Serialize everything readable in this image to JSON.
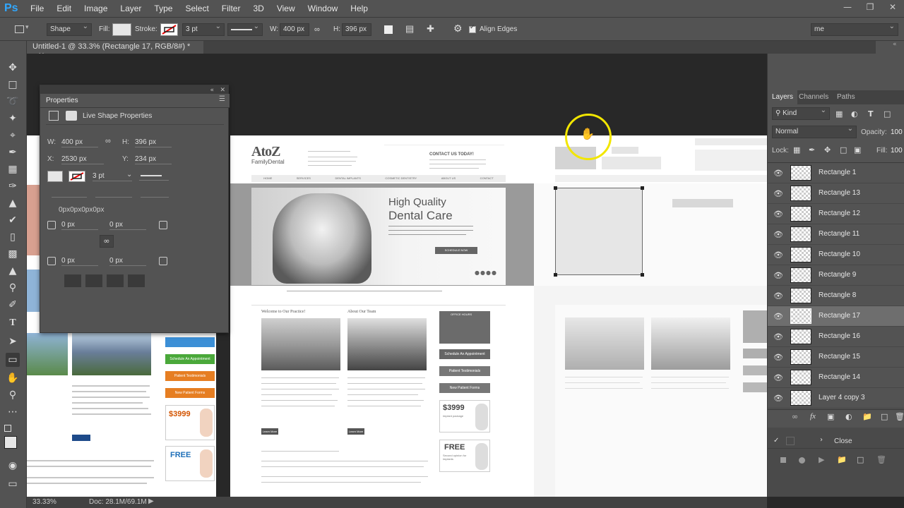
{
  "app": {
    "logo": "Ps",
    "menus": [
      "File",
      "Edit",
      "Image",
      "Layer",
      "Type",
      "Select",
      "Filter",
      "3D",
      "View",
      "Window",
      "Help"
    ]
  },
  "options": {
    "mode": "Shape",
    "fill_label": "Fill:",
    "stroke_label": "Stroke:",
    "stroke_width": "3 pt",
    "w_label": "W:",
    "w_value": "400 px",
    "h_label": "H:",
    "h_value": "396 px",
    "align_edges": "Align Edges",
    "workspace": "me"
  },
  "document": {
    "tab": "Untitled-1 @ 33.3% (Rectangle 17, RGB/8#) *"
  },
  "properties": {
    "title": "Properties",
    "subtitle": "Live Shape Properties",
    "w_label": "W:",
    "w": "400 px",
    "h_label": "H:",
    "h": "396 px",
    "x_label": "X:",
    "x": "2530 px",
    "y_label": "Y:",
    "y": "234 px",
    "stroke": "3 pt",
    "radii": "0px0px0px0px",
    "r1": "0 px",
    "r2": "0 px",
    "r3": "0 px",
    "r4": "0 px"
  },
  "panels": {
    "tabs": [
      "Layers",
      "Channels",
      "Paths"
    ],
    "filter": "Kind",
    "blend": "Normal",
    "opacity_label": "Opacity:",
    "opacity": "100",
    "lock_label": "Lock:",
    "fill_label": "Fill:",
    "fill": "100",
    "layers": [
      {
        "name": "Rectangle 1",
        "selected": false
      },
      {
        "name": "Rectangle 13",
        "selected": false
      },
      {
        "name": "Rectangle 12",
        "selected": false
      },
      {
        "name": "Rectangle 11",
        "selected": false
      },
      {
        "name": "Rectangle 10",
        "selected": false
      },
      {
        "name": "Rectangle 9",
        "selected": false
      },
      {
        "name": "Rectangle 8",
        "selected": false
      },
      {
        "name": "Rectangle 17",
        "selected": true
      },
      {
        "name": "Rectangle 16",
        "selected": false
      },
      {
        "name": "Rectangle 15",
        "selected": false
      },
      {
        "name": "Rectangle 14",
        "selected": false
      },
      {
        "name": "Layer 4 copy 3",
        "selected": false
      }
    ],
    "actions_close": "Close"
  },
  "status": {
    "zoom": "33.33%",
    "doc": "Doc: 28.1M/69.1M"
  },
  "website": {
    "logo_az": "AtoZ",
    "logo_sub": "FamilyDental",
    "contact": "CONTACT US TODAY!",
    "hero_title1": "High Quality",
    "hero_title2": "Dental Care",
    "hero_btn": "SCHEDULE NOW",
    "nav": [
      "HOME",
      "SERVICES",
      "DENTAL IMPLANTS",
      "COSMETIC DENTISTRY",
      "ABOUT US",
      "CONTACT"
    ],
    "welcome": "Welcome to Our Practice!",
    "about": "About Our Team",
    "hours": "OFFICE HOURS",
    "btn1": "Schedule An Appointment",
    "btn2": "Patient Testimonials",
    "btn3": "New Patient Forms",
    "price": "$3999",
    "price_sub": "implant package",
    "free": "FREE",
    "free_sub": "Second opinion for implants",
    "learn": "Learn More"
  }
}
